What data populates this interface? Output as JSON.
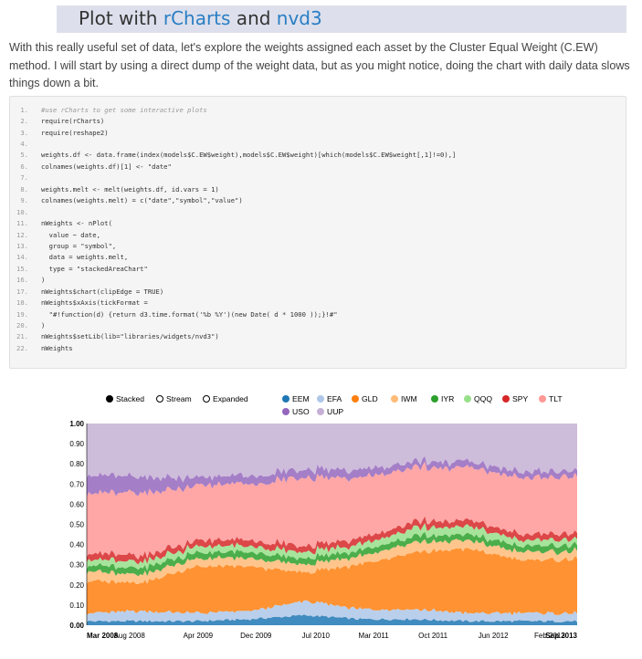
{
  "header": {
    "title_prefix": "Plot with ",
    "link1": "rCharts",
    "title_mid": " and ",
    "link2": "nvd3"
  },
  "intro": "With this really useful set of data, let's explore the weights assigned each asset by the Cluster Equal Weight (C.EW) method. I will start by using a direct dump of the weight data, but as you might notice, doing the chart with daily data slows things down a bit.",
  "code": [
    {
      "n": "1.",
      "text": "#use rCharts to get some interactive plots",
      "comment": true
    },
    {
      "n": "2.",
      "text": "require(rCharts)"
    },
    {
      "n": "3.",
      "text": "require(reshape2)"
    },
    {
      "n": "4.",
      "text": ""
    },
    {
      "n": "5.",
      "text": "weights.df <- data.frame(index(models$C.EW$weight),models$C.EW$weight)[which(models$C.EW$weight[,1]!=0),]"
    },
    {
      "n": "6.",
      "text": "colnames(weights.df)[1] <- \"date\""
    },
    {
      "n": "7.",
      "text": ""
    },
    {
      "n": "8.",
      "text": "weights.melt <- melt(weights.df, id.vars = 1)"
    },
    {
      "n": "9.",
      "text": "colnames(weights.melt) = c(\"date\",\"symbol\",\"value\")"
    },
    {
      "n": "10.",
      "text": ""
    },
    {
      "n": "11.",
      "text": "nWeights <- nPlot("
    },
    {
      "n": "12.",
      "text": "  value ~ date,"
    },
    {
      "n": "13.",
      "text": "  group = \"symbol\","
    },
    {
      "n": "14.",
      "text": "  data = weights.melt,"
    },
    {
      "n": "15.",
      "text": "  type = \"stackedAreaChart\""
    },
    {
      "n": "16.",
      "text": ")"
    },
    {
      "n": "17.",
      "text": "nWeights$chart(clipEdge = TRUE)"
    },
    {
      "n": "18.",
      "text": "nWeights$xAxis(tickFormat ="
    },
    {
      "n": "19.",
      "text": "  \"#!function(d) {return d3.time.format('%b %Y')(new Date( d * 1000 ));}!#\""
    },
    {
      "n": "20.",
      "text": ")"
    },
    {
      "n": "21.",
      "text": "nWeights$setLib(lib=\"libraries/widgets/nvd3\")"
    },
    {
      "n": "22.",
      "text": "nWeights"
    }
  ],
  "controls": [
    {
      "label": "Stacked",
      "selected": true
    },
    {
      "label": "Stream",
      "selected": false
    },
    {
      "label": "Expanded",
      "selected": false
    }
  ],
  "chart_data": {
    "type": "area",
    "stacked": true,
    "x_ticks": [
      "Mar 2008",
      "Aug 2008",
      "Apr 2009",
      "Dec 2009",
      "Jul 2010",
      "Mar 2011",
      "Oct 2011",
      "Jun 2012",
      "Feb 2013",
      "Sep 2013"
    ],
    "y_ticks": [
      "0.00",
      "0.10",
      "0.20",
      "0.30",
      "0.40",
      "0.50",
      "0.60",
      "0.70",
      "0.80",
      "0.90",
      "1.00"
    ],
    "ylim": [
      0,
      1
    ],
    "x": [
      "Mar 2008",
      "Aug 2008",
      "Apr 2009",
      "Dec 2009",
      "Jul 2010",
      "Mar 2011",
      "Oct 2011",
      "Jun 2012",
      "Feb 2013",
      "Sep 2013"
    ],
    "series": [
      {
        "name": "EEM",
        "color": "#1f77b4",
        "values": [
          0.02,
          0.02,
          0.02,
          0.03,
          0.05,
          0.03,
          0.03,
          0.02,
          0.02,
          0.02
        ]
      },
      {
        "name": "EFA",
        "color": "#aec7e8",
        "values": [
          0.04,
          0.05,
          0.04,
          0.04,
          0.07,
          0.05,
          0.05,
          0.04,
          0.04,
          0.04
        ]
      },
      {
        "name": "GLD",
        "color": "#ff7f0e",
        "values": [
          0.16,
          0.14,
          0.23,
          0.22,
          0.14,
          0.22,
          0.28,
          0.32,
          0.26,
          0.27
        ]
      },
      {
        "name": "IWM",
        "color": "#ffbb78",
        "values": [
          0.05,
          0.04,
          0.04,
          0.04,
          0.04,
          0.04,
          0.05,
          0.04,
          0.04,
          0.04
        ]
      },
      {
        "name": "IYR",
        "color": "#2ca02c",
        "values": [
          0.03,
          0.03,
          0.03,
          0.03,
          0.03,
          0.03,
          0.03,
          0.03,
          0.03,
          0.03
        ]
      },
      {
        "name": "QQQ",
        "color": "#98df8a",
        "values": [
          0.03,
          0.03,
          0.03,
          0.03,
          0.03,
          0.03,
          0.04,
          0.04,
          0.03,
          0.03
        ]
      },
      {
        "name": "SPY",
        "color": "#d62728",
        "values": [
          0.03,
          0.03,
          0.03,
          0.03,
          0.03,
          0.03,
          0.03,
          0.03,
          0.03,
          0.03
        ]
      },
      {
        "name": "TLT",
        "color": "#ff9896",
        "values": [
          0.3,
          0.31,
          0.27,
          0.28,
          0.34,
          0.3,
          0.27,
          0.26,
          0.28,
          0.28
        ]
      },
      {
        "name": "USO",
        "color": "#9467bd",
        "values": [
          0.09,
          0.08,
          0.04,
          0.04,
          0.04,
          0.04,
          0.03,
          0.03,
          0.03,
          0.03
        ]
      },
      {
        "name": "UUP",
        "color": "#c5b0d5",
        "values": [
          0.25,
          0.27,
          0.27,
          0.26,
          0.23,
          0.23,
          0.19,
          0.19,
          0.24,
          0.23
        ]
      }
    ],
    "grid": false,
    "legend": "top"
  }
}
